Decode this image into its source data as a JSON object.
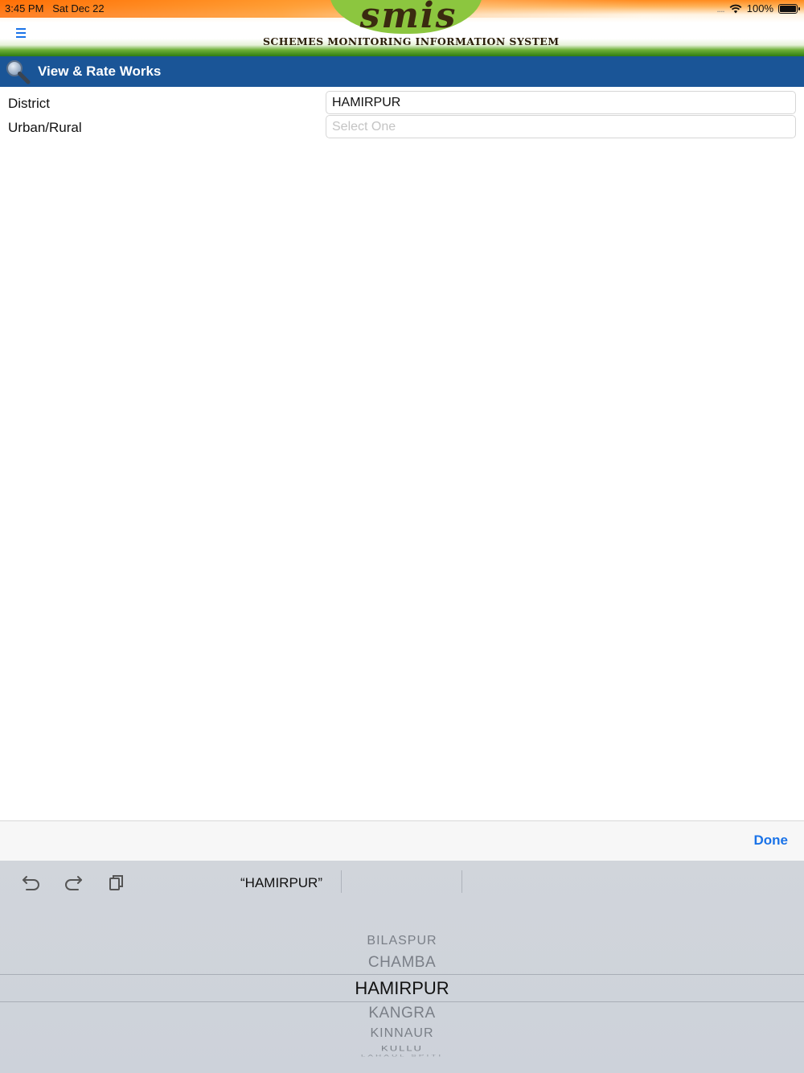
{
  "status_bar": {
    "time": "3:45 PM",
    "date": "Sat Dec 22",
    "battery": "100%",
    "signal_dots": "....",
    "icons": [
      "wifi-icon",
      "battery-icon"
    ]
  },
  "header": {
    "logo_script": "smis",
    "logo_caption": "SCHEMES MONITORING INFORMATION SYSTEM",
    "menu_icon": "hamburger-menu-icon"
  },
  "title_bar": {
    "title": "View & Rate Works",
    "icon": "search-icon"
  },
  "form": {
    "district": {
      "label": "District",
      "value": "HAMIRPUR"
    },
    "urban_rural": {
      "label": "Urban/Rural",
      "placeholder": "Select One"
    }
  },
  "picker_toolbar": {
    "done_label": "Done"
  },
  "keyboard_bar": {
    "icons": [
      "undo-icon",
      "redo-icon",
      "paste-icon"
    ],
    "suggestion": "“HAMIRPUR”"
  },
  "picker": {
    "items": [
      "BILASPUR",
      "CHAMBA",
      "HAMIRPUR",
      "KANGRA",
      "KINNAUR",
      "KULLU",
      "LAHAUL SPITI"
    ],
    "selected": "HAMIRPUR"
  },
  "colors": {
    "title_bar": "#1a5597",
    "accent": "#1a73e8",
    "logo_green": "#8cc63f"
  }
}
